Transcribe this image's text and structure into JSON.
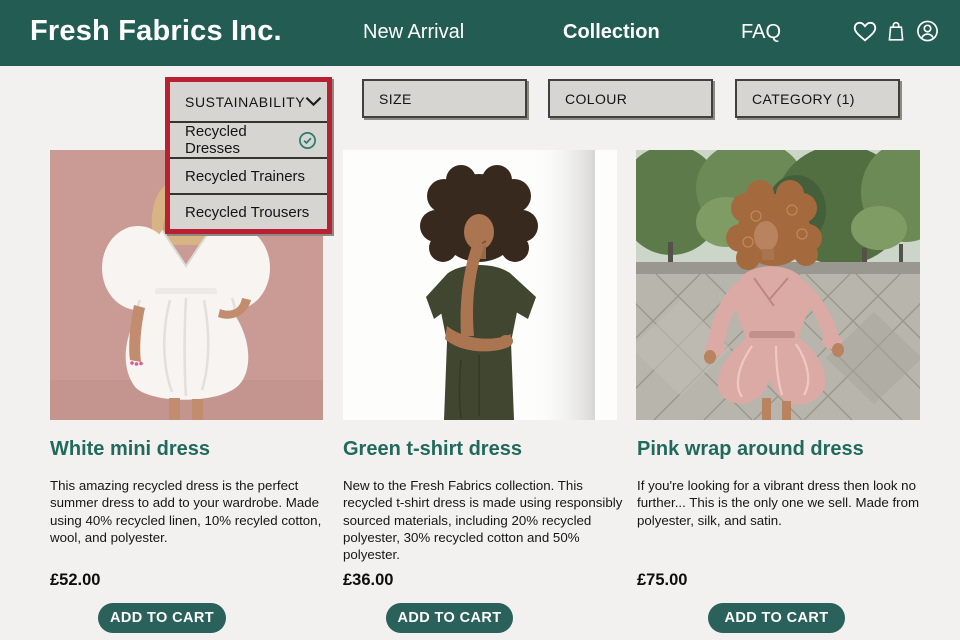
{
  "colors": {
    "header_bg": "#235c53",
    "page_bg": "#f2f1ef",
    "title_teal": "#21695c",
    "cta_bg": "#2a615a",
    "dropdown_highlight_red": "#b92031",
    "filter_button_bg": "#d7d5d2",
    "check_icon_teal": "#2b7a6a",
    "photo1_bg_pink": "#c99b94",
    "photo2_bg_white": "#fdfdfc",
    "photo3_trees_green": "#5d7b4a",
    "photo3_pavement_grey": "#b7b5ac"
  },
  "header": {
    "logo": "Fresh Fabrics Inc.",
    "nav": [
      {
        "label": "New Arrival",
        "active": false
      },
      {
        "label": "Collection",
        "active": true
      },
      {
        "label": "FAQ",
        "active": false
      }
    ],
    "icons": [
      "wishlist-heart-icon",
      "shopping-bag-icon",
      "account-icon"
    ]
  },
  "filters": {
    "sustainability": {
      "label": "SUSTAINABILITY",
      "expanded": true,
      "options": [
        {
          "label": "Recycled Dresses",
          "selected": true
        },
        {
          "label": "Recycled Trainers",
          "selected": false
        },
        {
          "label": "Recycled Trousers",
          "selected": false
        }
      ]
    },
    "buttons": [
      {
        "label": "SIZE"
      },
      {
        "label": "COLOUR"
      },
      {
        "label": "CATEGORY (1)"
      }
    ]
  },
  "products": [
    {
      "title": "White mini dress",
      "description": "This amazing recycled dress is the perfect summer dress to add to your wardrobe. Made using 40% recycled linen, 10% recyled cotton, wool, and polyester.",
      "price": "£52.00",
      "cta": "ADD TO CART",
      "image": "white-mini-dress-photo"
    },
    {
      "title": "Green t-shirt dress",
      "description": "New to the Fresh Fabrics collection. This recycled t-shirt dress is made using responsibly sourced materials, including 20% recycled polyester, 30% recycled cotton and 50% polyester.",
      "price": "£36.00",
      "cta": "ADD TO CART",
      "image": "green-tshirt-dress-photo"
    },
    {
      "title": "Pink wrap around dress",
      "description": "If you're looking for a vibrant dress then look no further... This is the only one we sell. Made from polyester, silk, and satin.",
      "price": "£75.00",
      "cta": "ADD TO CART",
      "image": "pink-wrap-dress-photo"
    }
  ]
}
